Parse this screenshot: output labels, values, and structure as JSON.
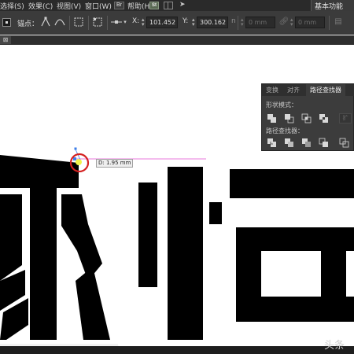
{
  "menubar": {
    "items": [
      {
        "label": "选择(S)"
      },
      {
        "label": "效果(C)"
      },
      {
        "label": "视图(V)"
      },
      {
        "label": "窗口(W)"
      },
      {
        "label": "帮助(H)"
      }
    ],
    "br_icon": "Br",
    "st_icon": "St",
    "workspace_label": "基本功能"
  },
  "controlbar": {
    "anchor_label": "锚点：",
    "x_label": "X:",
    "x_value": "101.452",
    "y_label": "Y:",
    "y_value": "300.162",
    "x_unit_peek": "n",
    "w_value": "0 mm",
    "h_value": "0 mm"
  },
  "tabbar": {
    "tab_label": "⊠"
  },
  "canvas": {
    "distance_label": "D: 1.95 mm",
    "glyph_colors": {
      "fill": "#000000",
      "guide": "#e04bd2",
      "anchor": "#3d7ee8",
      "cursor_ring": "#d42020",
      "cursor_dot": "#f2f24a"
    }
  },
  "panel": {
    "tabs": [
      {
        "label": "变换",
        "active": false
      },
      {
        "label": "对齐",
        "active": false
      },
      {
        "label": "路径查找器",
        "active": true
      }
    ],
    "shape_modes_label": "形状模式：",
    "pathfinder_label": "路径查找器：",
    "expand_label": "扩"
  },
  "video": {
    "progress_percent": 34,
    "watermark": "头条"
  }
}
